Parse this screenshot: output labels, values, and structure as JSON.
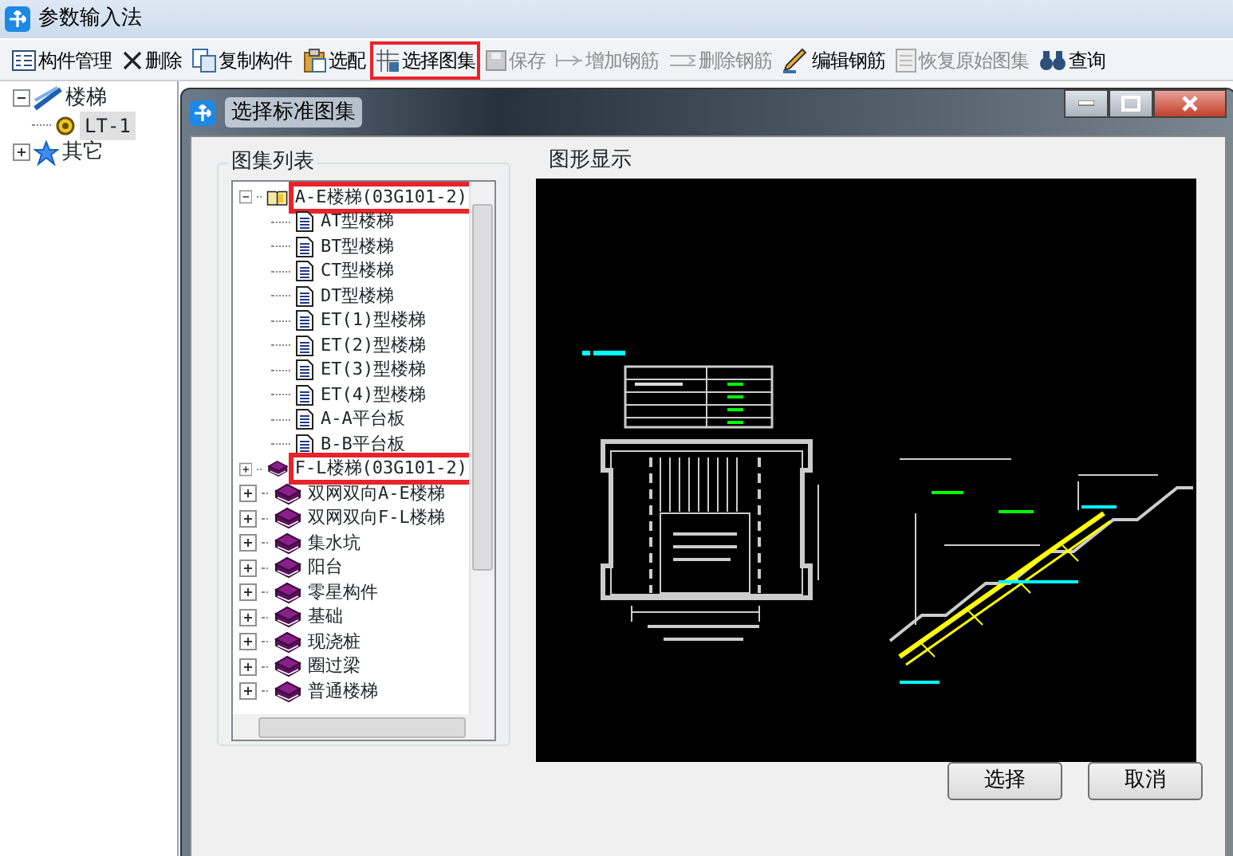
{
  "window": {
    "title": "参数输入法"
  },
  "toolbar": [
    {
      "label": "构件管理",
      "disabled": false,
      "highlighted": false
    },
    {
      "label": "删除",
      "disabled": false,
      "highlighted": false
    },
    {
      "label": "复制构件",
      "disabled": false,
      "highlighted": false
    },
    {
      "label": "选配",
      "disabled": false,
      "highlighted": false
    },
    {
      "label": "选择图集",
      "disabled": false,
      "highlighted": true
    },
    {
      "label": "保存",
      "disabled": true,
      "highlighted": false
    },
    {
      "label": "增加钢筋",
      "disabled": true,
      "highlighted": false
    },
    {
      "label": "删除钢筋",
      "disabled": true,
      "highlighted": false
    },
    {
      "label": "编辑钢筋",
      "disabled": false,
      "highlighted": false
    },
    {
      "label": "恢复原始图集",
      "disabled": true,
      "highlighted": false
    },
    {
      "label": "查询",
      "disabled": false,
      "highlighted": false
    }
  ],
  "tree": [
    {
      "label": "楼梯",
      "expanded": true,
      "children": [
        {
          "label": "LT-1",
          "selected": true
        }
      ]
    },
    {
      "label": "其它",
      "expanded": false
    }
  ],
  "dialog": {
    "title": "选择标准图集",
    "atlas_list": {
      "title": "图集列表",
      "items": [
        {
          "label": "A-E楼梯(03G101-2)",
          "expanded": true,
          "highlighted": true,
          "children": [
            {
              "label": "AT型楼梯"
            },
            {
              "label": "BT型楼梯"
            },
            {
              "label": "CT型楼梯"
            },
            {
              "label": "DT型楼梯"
            },
            {
              "label": "ET(1)型楼梯"
            },
            {
              "label": "ET(2)型楼梯"
            },
            {
              "label": "ET(3)型楼梯"
            },
            {
              "label": "ET(4)型楼梯"
            },
            {
              "label": "A-A平台板"
            },
            {
              "label": "B-B平台板"
            }
          ]
        },
        {
          "label": "F-L楼梯(03G101-2)",
          "expanded": false,
          "highlighted": true
        },
        {
          "label": "双网双向A-E楼梯",
          "expanded": false,
          "highlighted": false
        },
        {
          "label": "双网双向F-L楼梯",
          "expanded": false,
          "highlighted": false
        },
        {
          "label": "集水坑",
          "expanded": false,
          "highlighted": false
        },
        {
          "label": "阳台",
          "expanded": false,
          "highlighted": false
        },
        {
          "label": "零星构件",
          "expanded": false,
          "highlighted": false
        },
        {
          "label": "基础",
          "expanded": false,
          "highlighted": false
        },
        {
          "label": "现浇桩",
          "expanded": false,
          "highlighted": false
        },
        {
          "label": "圈过梁",
          "expanded": false,
          "highlighted": false
        },
        {
          "label": "普通楼梯",
          "expanded": false,
          "highlighted": false
        }
      ]
    },
    "preview": {
      "title": "图形显示"
    },
    "buttons": [
      "选择",
      "取消"
    ]
  }
}
